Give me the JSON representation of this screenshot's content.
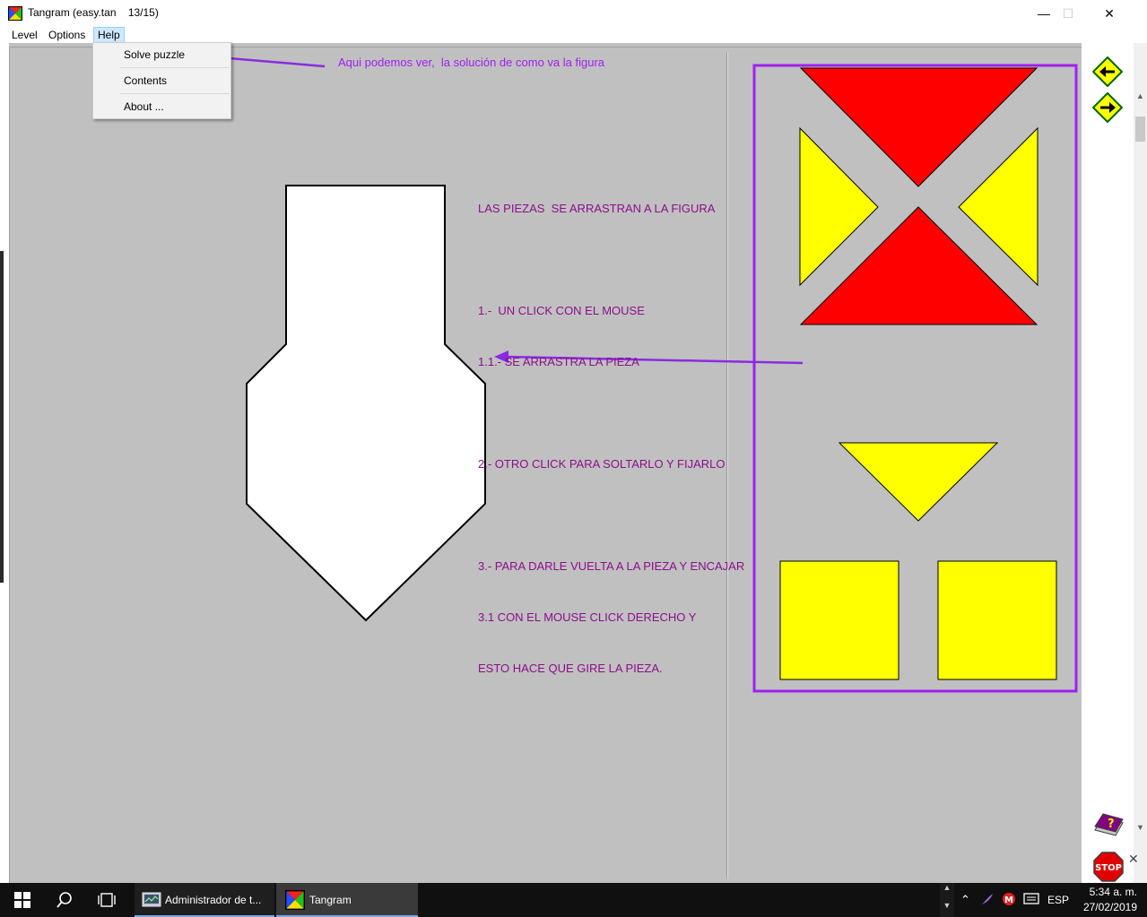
{
  "window": {
    "title": "Tangram (easy.tan    13/15)",
    "minimize": "—",
    "maximize": "☐",
    "close": "✕"
  },
  "menu": {
    "level": "Level",
    "options": "Options",
    "help": "Help"
  },
  "help_menu": {
    "solve": "Solve puzzle",
    "contents": "Contents",
    "about": "About ..."
  },
  "annotations": {
    "top": "Aqui podemos ver,  la solución de como va la figura",
    "instructions": [
      "LAS PIEZAS  SE ARRASTRAN A LA FIGURA",
      "",
      "1.-  UN CLICK CON EL MOUSE",
      "1.1.- SE ARRASTRA LA PIEZA",
      "",
      "2.- OTRO CLICK PARA SOLTARLO Y FIJARLO",
      "",
      "3.- PARA DARLE VUELTA A LA PIEZA Y ENCAJAR",
      "3.1 CON EL MOUSE CLICK DERECHO Y",
      "ESTO HACE QUE GIRE LA PIEZA."
    ],
    "annotation_color": "#a020f0",
    "text_color": "#8b0f8b"
  },
  "pieces": {
    "red": "#ff0000",
    "yellow": "#ffff00",
    "figure": "#ffffff"
  },
  "toolbar": {
    "prev_icon": "arrow-left-icon",
    "next_icon": "arrow-right-icon",
    "help_icon": "help-book-icon",
    "stop_icon": "stop-sign-icon",
    "stop_label": "STOP",
    "help_mark": "?"
  },
  "taskbar": {
    "admin_label": "Administrador de t...",
    "tangram_label": "Tangram",
    "language": "ESP",
    "time": "5:34 a. m.",
    "date": "27/02/2019"
  }
}
